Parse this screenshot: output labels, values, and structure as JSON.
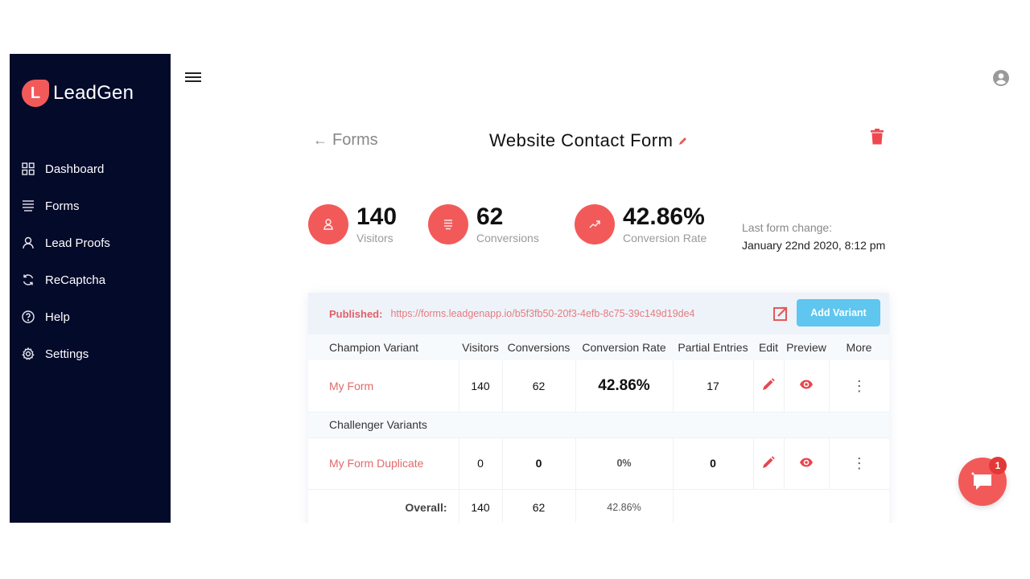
{
  "brand": {
    "logo_letter": "L",
    "name": "LeadGen",
    "accent": "#f25a5a",
    "sidebar_bg": "#030a2a"
  },
  "sidebar": {
    "items": [
      {
        "label": "Dashboard",
        "icon": "grid-icon"
      },
      {
        "label": "Forms",
        "icon": "list-icon"
      },
      {
        "label": "Lead Proofs",
        "icon": "user-icon"
      },
      {
        "label": "ReCaptcha",
        "icon": "refresh-icon"
      },
      {
        "label": "Help",
        "icon": "help-circle-icon"
      },
      {
        "label": "Settings",
        "icon": "gear-icon"
      }
    ]
  },
  "header": {
    "back_arrow": "←",
    "back_label": "Forms",
    "title": "Website Contact Form"
  },
  "stats": {
    "visitors": {
      "value": "140",
      "label": "Visitors"
    },
    "conversions": {
      "value": "62",
      "label": "Conversions"
    },
    "rate": {
      "value": "42.86%",
      "label": "Conversion Rate"
    },
    "last_change_label": "Last form change:",
    "last_change_value": "January 22nd 2020, 8:12 pm"
  },
  "publish": {
    "label": "Published:",
    "url": "https://forms.leadgenapp.io/b5f3fb50-20f3-4efb-8c75-39c149d19de4",
    "add_variant_label": "Add Variant"
  },
  "table": {
    "headers": [
      "Champion Variant",
      "Visitors",
      "Conversions",
      "Conversion Rate",
      "Partial Entries",
      "Edit",
      "Preview",
      "More"
    ],
    "champion": {
      "name": "My Form",
      "visitors": "140",
      "conversions": "62",
      "rate": "42.86%",
      "partial": "17"
    },
    "challenger_section": "Challenger Variants",
    "challenger": {
      "name": "My Form Duplicate",
      "visitors": "0",
      "conversions": "0",
      "rate": "0%",
      "partial": "0"
    },
    "overall": {
      "label": "Overall:",
      "visitors": "140",
      "conversions": "62",
      "rate": "42.86%"
    }
  },
  "chat": {
    "badge_count": "1"
  },
  "more_glyph": "⋮"
}
